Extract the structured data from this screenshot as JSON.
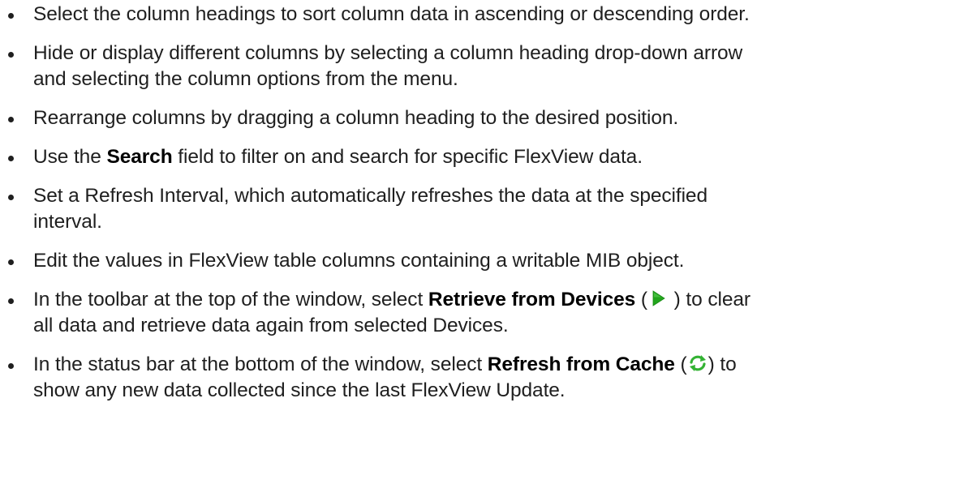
{
  "bullets": {
    "item1": {
      "text": "Select the column headings to sort column data in ascending or descending order."
    },
    "item2": {
      "line1": "Hide or display different columns by selecting a column heading drop-down arrow",
      "line2": "and selecting the column options from the menu."
    },
    "item3": {
      "text": "Rearrange columns by dragging a column heading to the desired position."
    },
    "item4": {
      "pre": "Use the ",
      "bold": "Search",
      "post": " field to filter on and search for specific FlexView data."
    },
    "item5": {
      "line1": "Set a Refresh Interval, which automatically refreshes the data at the specified",
      "line2": "interval."
    },
    "item6": {
      "text": "Edit the values in FlexView table columns containing a writable MIB object."
    },
    "item7": {
      "pre": "In the toolbar at the top of the window, select ",
      "bold": "Retrieve from Devices",
      "open": " (",
      "close": " ) to clear",
      "line2": "all data and retrieve data again from selected Devices.",
      "icon": "play-icon"
    },
    "item8": {
      "pre": "In the status bar at the bottom of the window, select ",
      "bold": "Refresh from Cache",
      "open": " (",
      "close": ") to",
      "line2": "show any new data collected since the last FlexView Update.",
      "icon": "refresh-icon"
    }
  },
  "colors": {
    "play_icon": "#22a51c",
    "refresh_icon": "#33b233"
  }
}
